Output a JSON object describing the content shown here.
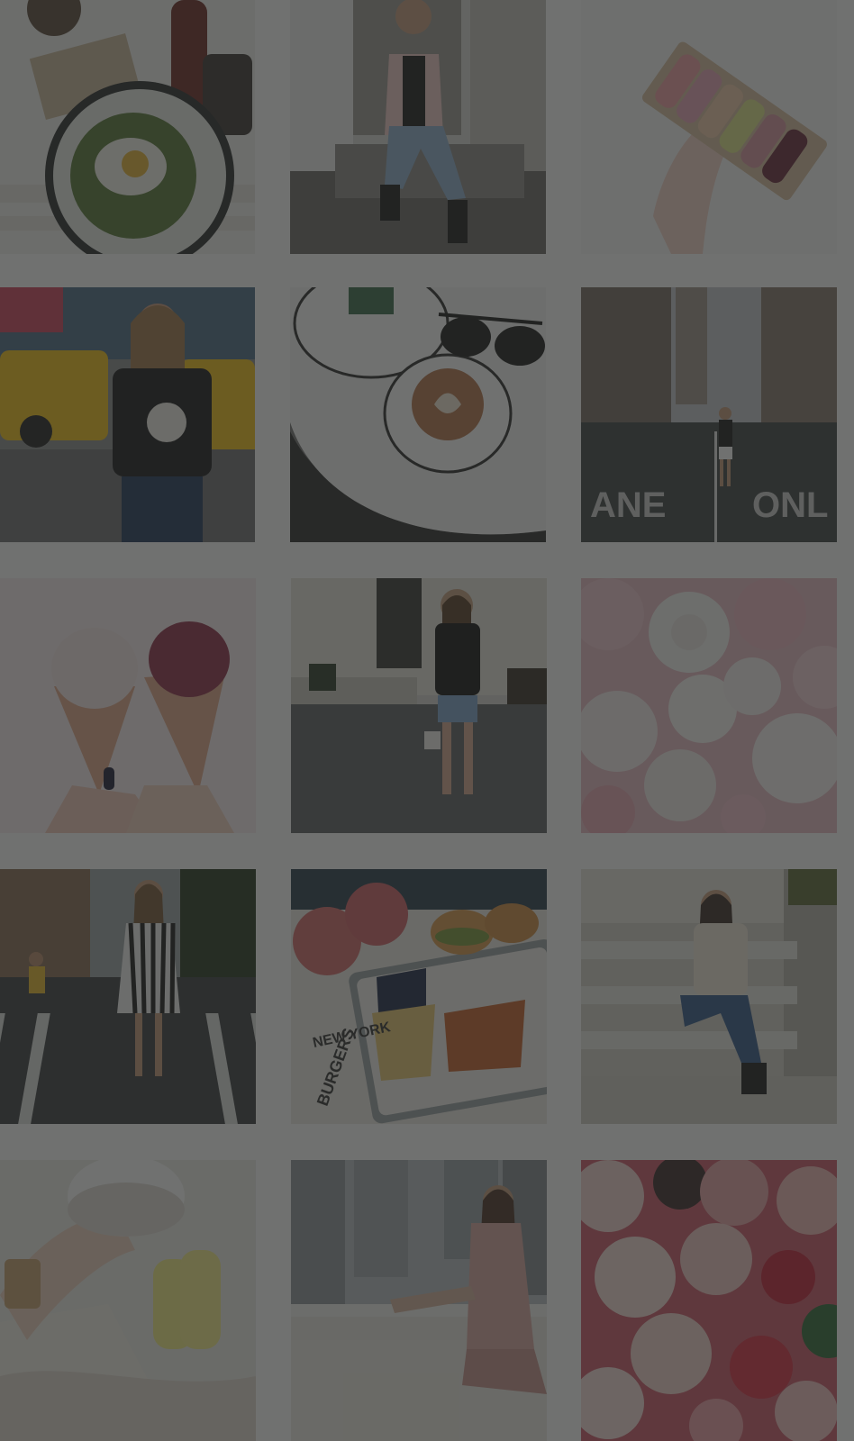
{
  "gallery": {
    "overlay_color": "#262826",
    "tiles": [
      {
        "icon": "food-table-photo"
      },
      {
        "icon": "woman-sitting-steps-photo"
      },
      {
        "icon": "macarons-box-photo"
      },
      {
        "icon": "woman-taxis-photo"
      },
      {
        "icon": "coffee-sunglasses-photo"
      },
      {
        "icon": "woman-street-photo"
      },
      {
        "icon": "ice-cream-cones-photo"
      },
      {
        "icon": "woman-building-photo"
      },
      {
        "icon": "white-roses-photo"
      },
      {
        "icon": "woman-crosswalk-photo"
      },
      {
        "icon": "burger-fries-tray-photo"
      },
      {
        "icon": "woman-stairs-photo"
      },
      {
        "icon": "coffee-cup-sneakers-photo"
      },
      {
        "icon": "woman-window-photo"
      },
      {
        "icon": "pink-red-roses-photo"
      }
    ]
  }
}
